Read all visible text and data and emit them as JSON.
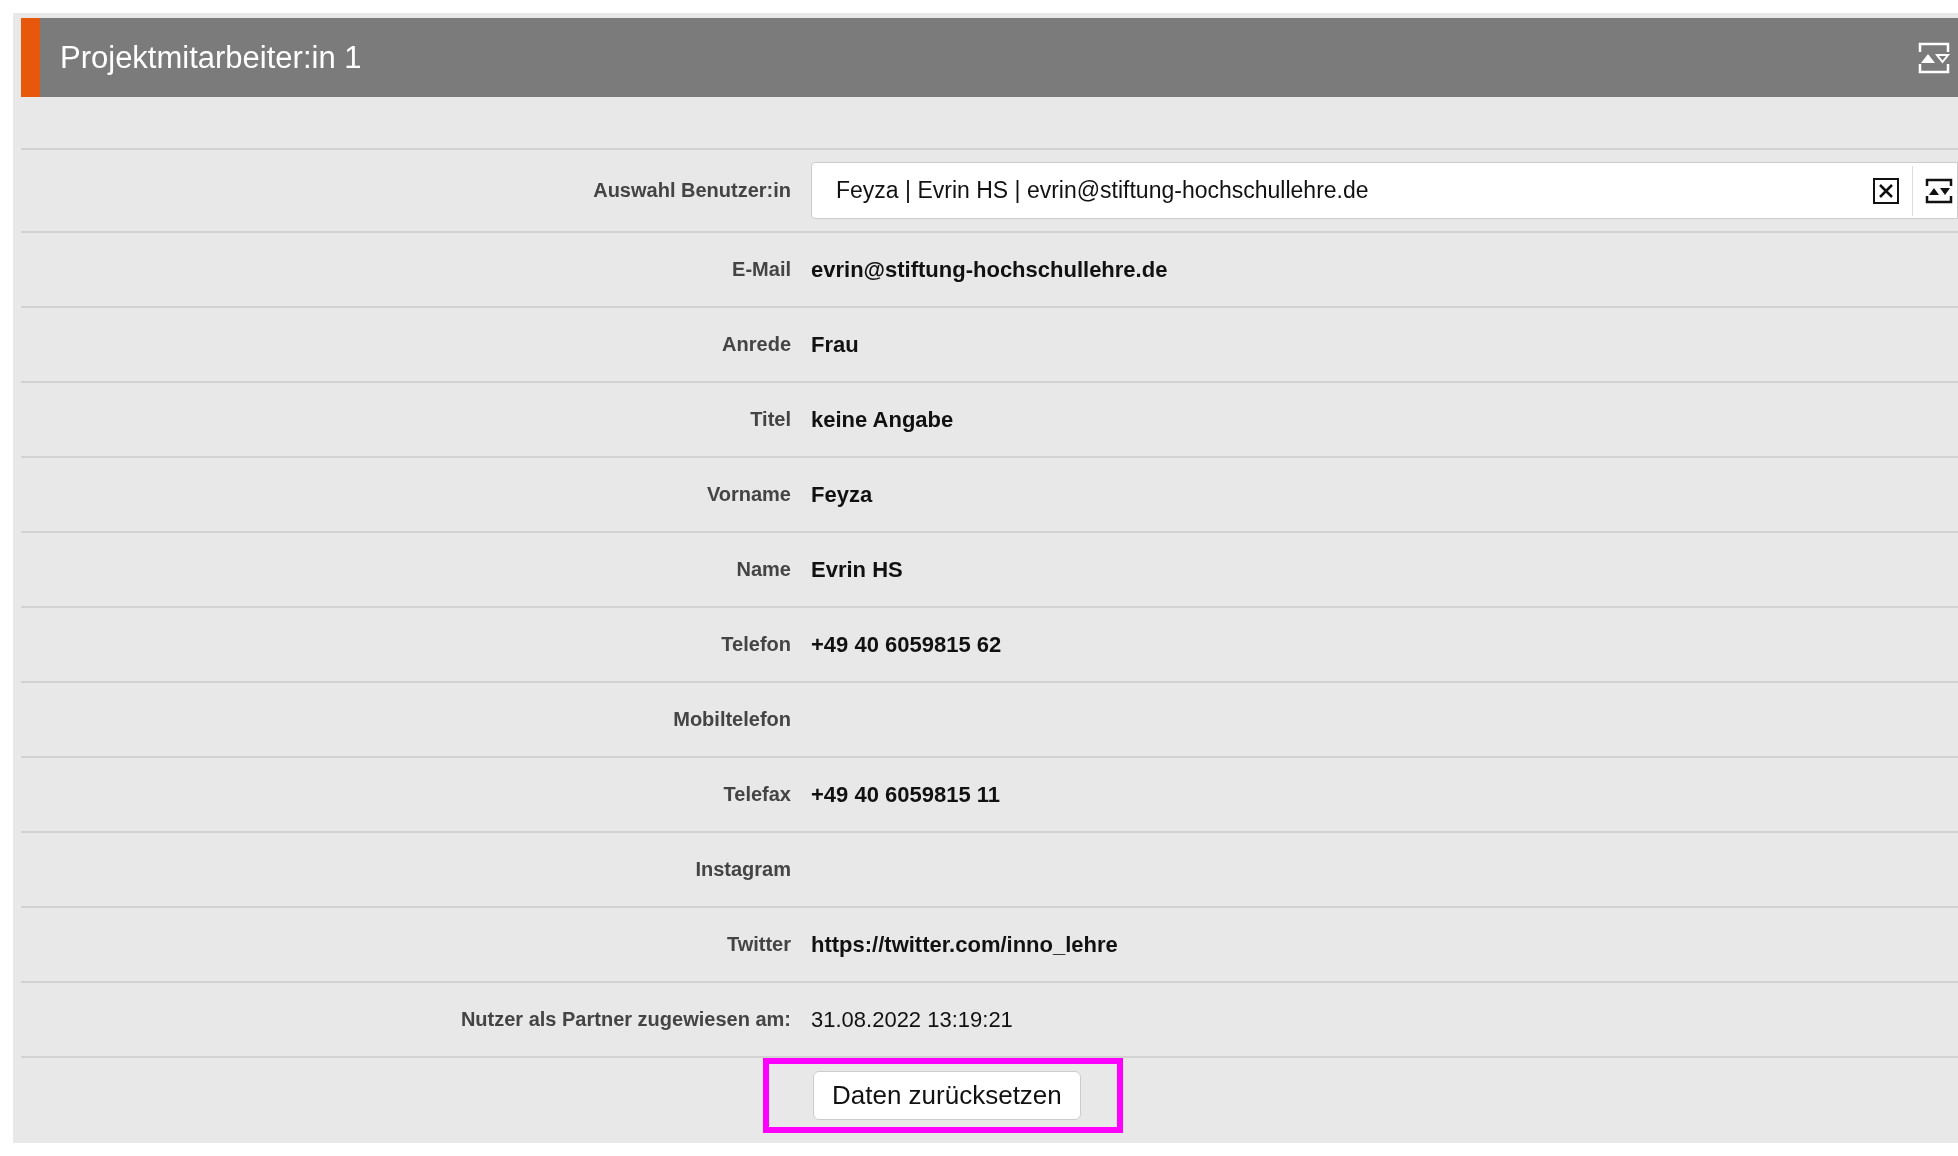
{
  "panel": {
    "title": "Projektmitarbeiter:in 1"
  },
  "rows": [
    {
      "kind": "select",
      "label": "Auswahl Benutzer:in",
      "value": "Feyza | Evrin HS | evrin@stiftung-hochschullehre.de"
    },
    {
      "kind": "field",
      "label": "E-Mail",
      "value": "evrin@stiftung-hochschullehre.de"
    },
    {
      "kind": "field",
      "label": "Anrede",
      "value": "Frau"
    },
    {
      "kind": "field",
      "label": "Titel",
      "value": "keine Angabe"
    },
    {
      "kind": "field",
      "label": "Vorname",
      "value": "Feyza"
    },
    {
      "kind": "field",
      "label": "Name",
      "value": "Evrin HS"
    },
    {
      "kind": "field",
      "label": "Telefon",
      "value": "+49 40 6059815 62"
    },
    {
      "kind": "field",
      "label": "Mobiltelefon"
    },
    {
      "kind": "field",
      "label": "Telefax",
      "value": "+49 40 6059815 11"
    },
    {
      "kind": "field",
      "label": "Instagram"
    },
    {
      "kind": "field",
      "label": "Twitter",
      "value": "https://twitter.com/inno_lehre"
    },
    {
      "kind": "plain",
      "label": "Nutzer als Partner zugewiesen am:",
      "value": "31.08.2022 13:19:21"
    }
  ],
  "reset_button": {
    "label": "Daten zurücksetzen",
    "highlighted": true
  }
}
